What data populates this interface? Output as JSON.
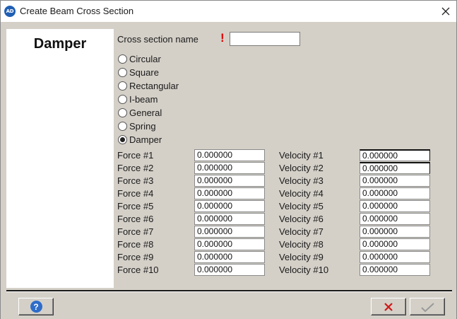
{
  "window": {
    "title": "Create Beam Cross Section",
    "app_icon_text": "AD"
  },
  "left_panel": {
    "title": "Damper"
  },
  "name_field": {
    "label": "Cross section name",
    "required_mark": "!",
    "value": ""
  },
  "section_types": [
    {
      "label": "Circular",
      "selected": false
    },
    {
      "label": "Square",
      "selected": false
    },
    {
      "label": "Rectangular",
      "selected": false
    },
    {
      "label": "I-beam",
      "selected": false
    },
    {
      "label": "General",
      "selected": false
    },
    {
      "label": "Spring",
      "selected": false
    },
    {
      "label": "Damper",
      "selected": true
    }
  ],
  "forces": [
    {
      "label": "Force #1",
      "value": "0.000000"
    },
    {
      "label": "Force #2",
      "value": "0.000000"
    },
    {
      "label": "Force #3",
      "value": "0.000000"
    },
    {
      "label": "Force #4",
      "value": "0.000000"
    },
    {
      "label": "Force #5",
      "value": "0.000000"
    },
    {
      "label": "Force #6",
      "value": "0.000000"
    },
    {
      "label": "Force #7",
      "value": "0.000000"
    },
    {
      "label": "Force #8",
      "value": "0.000000"
    },
    {
      "label": "Force #9",
      "value": "0.000000"
    },
    {
      "label": "Force #10",
      "value": "0.000000"
    }
  ],
  "velocities": [
    {
      "label": "Velocity #1",
      "value": "0.000000"
    },
    {
      "label": "Velocity #2",
      "value": "0.000000"
    },
    {
      "label": "Velocity #3",
      "value": "0.000000"
    },
    {
      "label": "Velocity #4",
      "value": "0.000000"
    },
    {
      "label": "Velocity #5",
      "value": "0.000000"
    },
    {
      "label": "Velocity #6",
      "value": "0.000000"
    },
    {
      "label": "Velocity #7",
      "value": "0.000000"
    },
    {
      "label": "Velocity #8",
      "value": "0.000000"
    },
    {
      "label": "Velocity #9",
      "value": "0.000000"
    },
    {
      "label": "Velocity #10",
      "value": "0.000000"
    }
  ],
  "buttons": {
    "help_icon": "help-icon",
    "help_glyph": "?",
    "cancel_icon": "red-x-icon",
    "ok_icon": "checkmark-icon"
  },
  "colors": {
    "dialog_bg": "#d4d0c8",
    "required": "#e00000",
    "cancel": "#d01818",
    "help": "#2e6cc9"
  }
}
